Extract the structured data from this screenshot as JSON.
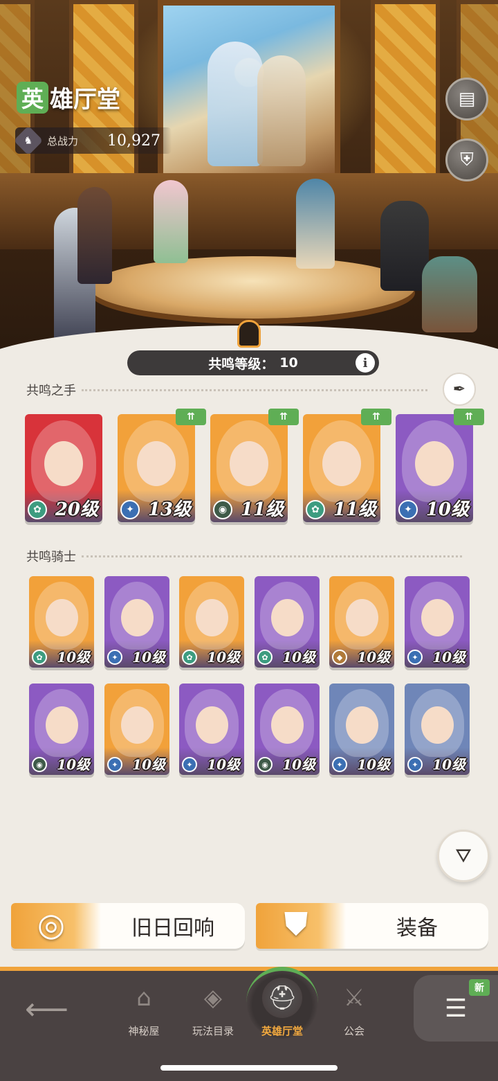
{
  "header": {
    "title_badge": "英",
    "title_rest": "雄厅堂",
    "power_label": "总战力",
    "power_value": "10,927"
  },
  "resonance": {
    "label": "共鸣等级：",
    "value": "10",
    "info_icon": "i"
  },
  "sections": {
    "hands_title": "共鸣之手",
    "knights_title": "共鸣骑士"
  },
  "hands": [
    {
      "level": "20级",
      "bg": "#d8333a",
      "class_color": "#3d9c80",
      "class_icon": "leaf-icon",
      "glyph": "✿",
      "upgrade": false
    },
    {
      "level": "13级",
      "bg": "#f2a13a",
      "class_color": "#3b6fb3",
      "class_icon": "star-icon",
      "glyph": "✦",
      "upgrade": true
    },
    {
      "level": "11级",
      "bg": "#f2a13a",
      "class_color": "#3e5a48",
      "class_icon": "eye-icon",
      "glyph": "◉",
      "upgrade": true
    },
    {
      "level": "11级",
      "bg": "#f2a13a",
      "class_color": "#3d9c80",
      "class_icon": "leaf-icon",
      "glyph": "✿",
      "upgrade": true
    },
    {
      "level": "10级",
      "bg": "#8c5ac2",
      "class_color": "#3b6fb3",
      "class_icon": "star-icon",
      "glyph": "✦",
      "upgrade": true
    }
  ],
  "upgrade_badge": "⇈",
  "knights": [
    {
      "level": "10级",
      "bg": "#f2a13a",
      "class_color": "#3d9c80",
      "class_icon": "leaf-icon",
      "glyph": "✿"
    },
    {
      "level": "10级",
      "bg": "#8c5ac2",
      "class_color": "#3b6fb3",
      "class_icon": "star-icon",
      "glyph": "✦"
    },
    {
      "level": "10级",
      "bg": "#f2a13a",
      "class_color": "#3d9c80",
      "class_icon": "leaf-icon",
      "glyph": "✿"
    },
    {
      "level": "10级",
      "bg": "#8c5ac2",
      "class_color": "#3d9c80",
      "class_icon": "leaf-icon",
      "glyph": "✿"
    },
    {
      "level": "10级",
      "bg": "#f2a13a",
      "class_color": "#b07a3a",
      "class_icon": "pin-icon",
      "glyph": "◆"
    },
    {
      "level": "10级",
      "bg": "#8c5ac2",
      "class_color": "#3b6fb3",
      "class_icon": "star-icon",
      "glyph": "✦"
    },
    {
      "level": "10级",
      "bg": "#8c5ac2",
      "class_color": "#3e5a48",
      "class_icon": "eye-icon",
      "glyph": "◉"
    },
    {
      "level": "10级",
      "bg": "#f2a13a",
      "class_color": "#3b6fb3",
      "class_icon": "star-icon",
      "glyph": "✦"
    },
    {
      "level": "10级",
      "bg": "#8c5ac2",
      "class_color": "#3b6fb3",
      "class_icon": "star-icon",
      "glyph": "✦"
    },
    {
      "level": "10级",
      "bg": "#8c5ac2",
      "class_color": "#3e5a48",
      "class_icon": "eye-icon",
      "glyph": "◉"
    },
    {
      "level": "10级",
      "bg": "#6f86b8",
      "class_color": "#3b6fb3",
      "class_icon": "star-icon",
      "glyph": "✦"
    },
    {
      "level": "10级",
      "bg": "#6f86b8",
      "class_color": "#3b6fb3",
      "class_icon": "star-icon",
      "glyph": "✦"
    }
  ],
  "actions": {
    "echoes_label": "旧日回响",
    "equipment_label": "装备"
  },
  "nav": {
    "items": [
      {
        "label": "神秘屋",
        "icon": "house-icon"
      },
      {
        "label": "玩法目录",
        "icon": "book-lock-icon"
      },
      {
        "label": "英雄厅堂",
        "icon": "helmet-icon"
      },
      {
        "label": "公会",
        "icon": "guild-icon"
      }
    ],
    "new_badge": "新"
  },
  "colors": {
    "accent_green": "#5fae55",
    "accent_orange": "#f0a33b",
    "nav_bg": "#4a4242"
  }
}
